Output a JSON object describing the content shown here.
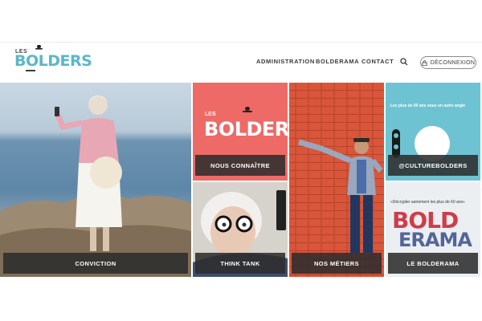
{
  "header": {
    "logo": {
      "small_text": "LES",
      "word": "BOLDERS",
      "icon": "bowler-hat-icon"
    },
    "nav": {
      "items": [
        {
          "label": "ADMINISTRATION"
        },
        {
          "label": "BOLDERAMA"
        },
        {
          "label": "CONTACT"
        }
      ],
      "search_icon": "search-icon",
      "logout_label": "DÉCONNEXION",
      "logout_icon": "lock-icon"
    }
  },
  "tiles": [
    {
      "label": "CONVICTION",
      "image": "senior-woman-selfie-seaside"
    },
    {
      "label": "NOUS CONNAÎTRE",
      "image": "les-bolders-logo-on-coral",
      "logo_small": "LES",
      "logo_word": "BOLDERS"
    },
    {
      "label": "THINK TANK",
      "image": "senior-woman-glasses-phone"
    },
    {
      "label": "NOS MÉTIERS",
      "image": "senior-man-against-brick-wall"
    },
    {
      "label": "@CULTUREBOLDERS",
      "image": "culture-bolders-poster",
      "poster_text": "Les plus de 60 ans sous un autre angle"
    },
    {
      "label": "LE BOLDERAMA",
      "image": "bolderama-poster",
      "poster_text": "«Décrypter autrement les plus de 60 ans»",
      "poster_word_1": "BOLD",
      "poster_word_2": "ERAMA"
    }
  ],
  "colors": {
    "brand_teal": "#5ab8c8",
    "coral": "#ee6a67",
    "brick": "#d9563a",
    "sky_blue": "#6ec3d3",
    "label_bg": "#2d2d2d"
  }
}
